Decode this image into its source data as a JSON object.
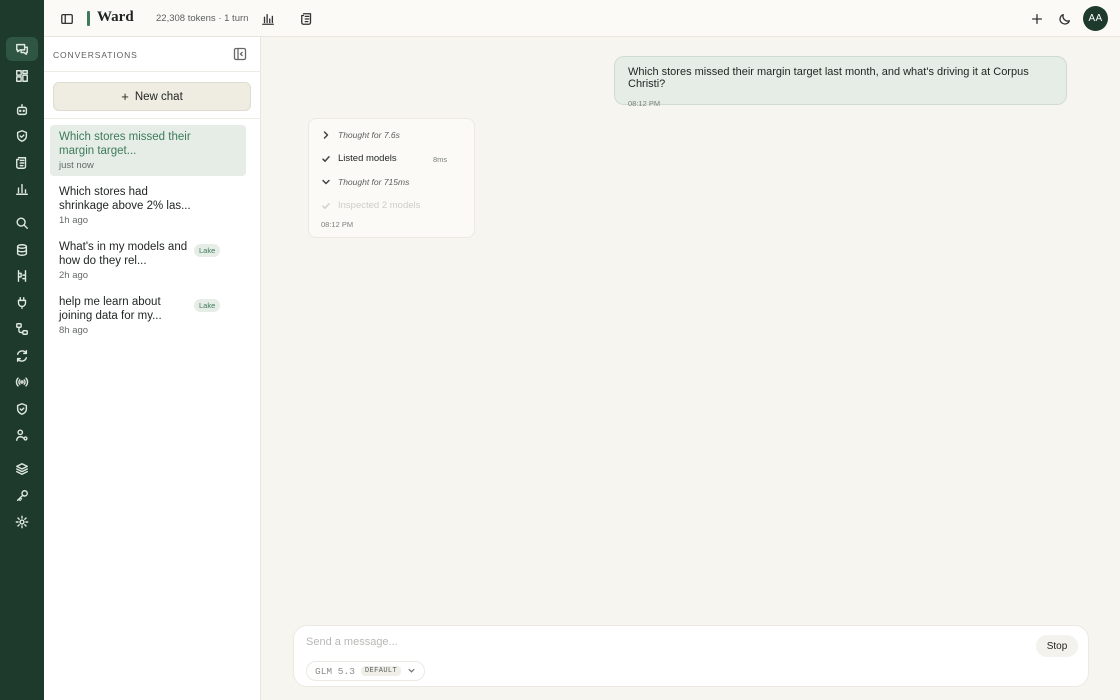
{
  "app": {
    "brand": "Ward",
    "token_info": "22,308 tokens · 1 turn",
    "avatar_initials": "AA"
  },
  "rail": {
    "icons": [
      "chat-icon",
      "grid-icon",
      "bot-icon",
      "shield-icon",
      "scroll-icon",
      "bar-chart-icon",
      "search-icon",
      "database-icon",
      "transform-icon",
      "plug-icon",
      "workflow-icon",
      "refresh-icon",
      "broadcast-icon",
      "shield-check-icon",
      "user-settings-icon",
      "layers-icon",
      "key-icon",
      "gear-icon"
    ]
  },
  "sidebar": {
    "header": "CONVERSATIONS",
    "new_chat_label": "New chat",
    "items": [
      {
        "title": "Which stores missed their margin target...",
        "time": "just now",
        "badge": ""
      },
      {
        "title": "Which stores had shrinkage above 2% las...",
        "time": "1h ago",
        "badge": ""
      },
      {
        "title": "What's in my models and how do they rel...",
        "time": "2h ago",
        "badge": "Lake"
      },
      {
        "title": "help me learn about joining data for my...",
        "time": "8h ago",
        "badge": "Lake"
      }
    ]
  },
  "chat": {
    "user_message": {
      "text": "Which stores missed their margin target last month, and what's driving it at Corpus Christi?",
      "time": "08:12 PM"
    },
    "assistant": {
      "steps": [
        {
          "label": "Thought for 7.6s",
          "duration": ""
        },
        {
          "label": "Listed models",
          "duration": "8ms"
        },
        {
          "label": "Thought for 715ms",
          "duration": ""
        },
        {
          "label": "Inspected 2 models",
          "duration": ""
        }
      ],
      "time": "08:12 PM"
    }
  },
  "composer": {
    "placeholder": "Send a message...",
    "stop_label": "Stop",
    "model_name": "GLM 5.3",
    "model_tag": "DEFAULT"
  },
  "colors": {
    "rail": "#1e3a2c",
    "accent": "#3e7a5b",
    "user_bubble": "#e5ede6"
  }
}
